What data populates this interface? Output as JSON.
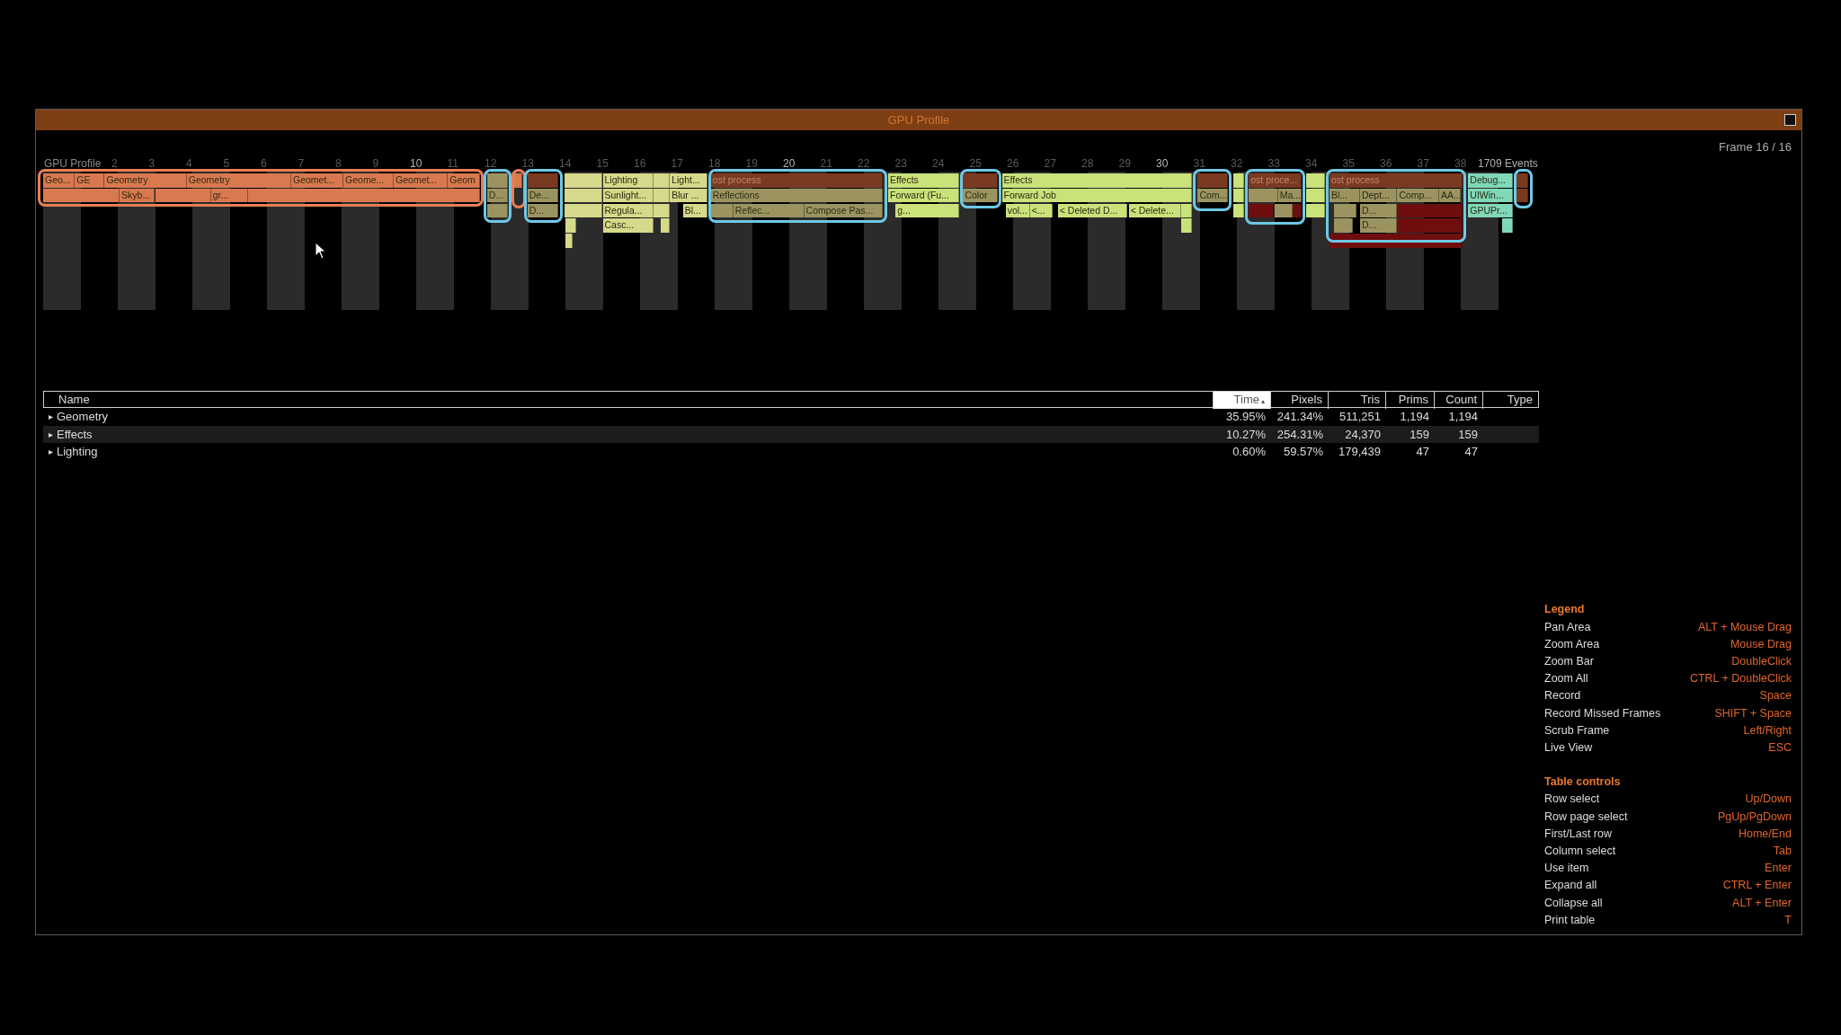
{
  "window": {
    "title": "GPU Profile",
    "frame_indicator": "Frame 16 / 16"
  },
  "timeline": {
    "title": "GPU Profile",
    "frame_labels": [
      {
        "label": "2",
        "major": false
      },
      {
        "label": "3",
        "major": false
      },
      {
        "label": "4",
        "major": false
      },
      {
        "label": "5",
        "major": false
      },
      {
        "label": "6",
        "major": false
      },
      {
        "label": "7",
        "major": false
      },
      {
        "label": "8",
        "major": false
      },
      {
        "label": "9",
        "major": false
      },
      {
        "label": "10",
        "major": true
      },
      {
        "label": "11",
        "major": false
      },
      {
        "label": "12",
        "major": false
      },
      {
        "label": "13",
        "major": false
      },
      {
        "label": "14",
        "major": false
      },
      {
        "label": "15",
        "major": false
      },
      {
        "label": "16",
        "major": false
      },
      {
        "label": "17",
        "major": false
      },
      {
        "label": "18",
        "major": false
      },
      {
        "label": "19",
        "major": false
      },
      {
        "label": "20",
        "major": true
      },
      {
        "label": "21",
        "major": false
      },
      {
        "label": "22",
        "major": false
      },
      {
        "label": "23",
        "major": false
      },
      {
        "label": "24",
        "major": false
      },
      {
        "label": "25",
        "major": false
      },
      {
        "label": "26",
        "major": false
      },
      {
        "label": "27",
        "major": false
      },
      {
        "label": "28",
        "major": false
      },
      {
        "label": "29",
        "major": false
      },
      {
        "label": "30",
        "major": true
      },
      {
        "label": "31",
        "major": false
      },
      {
        "label": "32",
        "major": false
      },
      {
        "label": "33",
        "major": false
      },
      {
        "label": "34",
        "major": false
      },
      {
        "label": "35",
        "major": false
      },
      {
        "label": "36",
        "major": false
      },
      {
        "label": "37",
        "major": false
      },
      {
        "label": "38",
        "major": false
      }
    ],
    "event_count": "1709 Events",
    "rows": [
      {
        "bars": [
          {
            "label": "Geo...",
            "color": "#d9794f"
          },
          {
            "label": "GE",
            "color": "#d9794f"
          },
          {
            "label": "Geometry",
            "color": "#d9794f"
          },
          {
            "label": "Geometry",
            "color": "#d9794f"
          },
          {
            "label": "Geomet...",
            "color": "#d9794f"
          },
          {
            "label": "Geome...",
            "color": "#d9794f"
          },
          {
            "label": "Geomet...",
            "color": "#d9794f"
          },
          {
            "label": "Geom",
            "color": "#d9794f"
          },
          {
            "color": "#9c9460"
          },
          {
            "color": "#d9794f"
          },
          {
            "color": "#7a3a22"
          },
          {
            "color": "#d6d98a"
          },
          {
            "label": "Lighting",
            "color": "#d6d98a"
          },
          {
            "color": "#d6d98a"
          },
          {
            "label": "Light...",
            "color": "#d6d98a"
          },
          {
            "label": "ost process",
            "color": "#7a3a22"
          },
          {
            "label": "Effects",
            "color": "#c9e27a"
          },
          {
            "color": "#7a3a22"
          },
          {
            "label": "Effects",
            "color": "#c9e27a"
          },
          {
            "color": "#7a3a22"
          },
          {
            "color": "#c9e27a"
          },
          {
            "label": "ost proce...",
            "color": "#7a3a22"
          },
          {
            "color": "#c9e27a"
          },
          {
            "label": "ost process",
            "color": "#7a3a22"
          },
          {
            "label": "Debug...",
            "color": "#7fd8b8"
          },
          {
            "color": "#7a3a22"
          }
        ]
      },
      {
        "bars": [
          {
            "color": "#d9794f"
          },
          {
            "label": "Skyb...",
            "color": "#d9794f"
          },
          {
            "color": "#d9794f"
          },
          {
            "label": "gr...",
            "color": "#d9794f"
          },
          {
            "color": "#d9794f"
          },
          {
            "label": "D...",
            "color": "#9c9460"
          },
          {
            "label": "De...",
            "color": "#9c9460"
          },
          {
            "color": "#d6d98a"
          },
          {
            "label": "Sunlight...",
            "color": "#d6d98a"
          },
          {
            "color": "#d6d98a"
          },
          {
            "label": "Blur ...",
            "color": "#d6d98a"
          },
          {
            "label": "Reflections",
            "color": "#9c9460"
          },
          {
            "label": "Forward (Fu...",
            "color": "#c9e27a"
          },
          {
            "label": "Color",
            "color": "#9c9460"
          },
          {
            "label": "Forward Job",
            "color": "#c9e27a"
          },
          {
            "label": "Com...",
            "color": "#9c9460"
          },
          {
            "color": "#c9e27a"
          },
          {
            "color": "#9c9460"
          },
          {
            "label": "Ma...",
            "color": "#9c9460"
          },
          {
            "color": "#c9e27a"
          },
          {
            "label": "Bl...",
            "color": "#9c9460"
          },
          {
            "label": "Dept...",
            "color": "#9c9460"
          },
          {
            "label": "Comp...",
            "color": "#9c9460"
          },
          {
            "label": "AA...",
            "color": "#9c9460"
          },
          {
            "label": "UIWin...",
            "color": "#7fd8b8"
          },
          {
            "color": "#7a3a22"
          }
        ]
      },
      {
        "bars": [
          {
            "color": "#9c9460"
          },
          {
            "label": "D...",
            "color": "#9c9460"
          },
          {
            "color": "#d6d98a"
          },
          {
            "label": "Regula...",
            "color": "#d6d98a"
          },
          {
            "color": "#d6d98a"
          },
          {
            "label": "Bl...",
            "color": "#d6d98a"
          },
          {
            "color": "#9c9460"
          },
          {
            "label": "Reflec...",
            "color": "#9c9460"
          },
          {
            "label": "Compose Pas...",
            "color": "#9c9460"
          },
          {
            "label": "g...",
            "color": "#c9e27a"
          },
          {
            "label": "vol...",
            "color": "#c9e27a"
          },
          {
            "label": "<...",
            "color": "#c9e27a"
          },
          {
            "label": "< Deleted D...",
            "color": "#c9e27a"
          },
          {
            "label": "< Delete...",
            "color": "#c9e27a"
          },
          {
            "color": "#c9e27a"
          },
          {
            "color": "#c9e27a"
          },
          {
            "color": "#6e0e0e"
          },
          {
            "color": "#9c9460"
          },
          {
            "color": "#6e0e0e"
          },
          {
            "color": "#c9e27a"
          },
          {
            "color": "#9c9460"
          },
          {
            "label": "D...",
            "color": "#9c9460"
          },
          {
            "color": "#6e0e0e"
          },
          {
            "label": "GPUPr...",
            "color": "#7fd8b8"
          }
        ]
      },
      {
        "bars": [
          {
            "color": "#d6d98a"
          },
          {
            "label": "Casc...",
            "color": "#d6d98a"
          },
          {
            "color": "#d6d98a"
          },
          {
            "color": "#c9e27a"
          },
          {
            "color": "#9c9460"
          },
          {
            "label": "D...",
            "color": "#9c9460"
          },
          {
            "color": "#6e0e0e"
          },
          {
            "color": "#7fd8b8"
          }
        ]
      },
      {
        "bars": [
          {
            "color": "#d6d98a"
          },
          {
            "color": "#6e0e0e"
          }
        ]
      }
    ],
    "annotations": [
      {
        "color": "#ee7d55"
      },
      {
        "color": "#ee7d55"
      },
      {
        "color": "#6fc8e6"
      },
      {
        "color": "#6fc8e6"
      },
      {
        "color": "#6fc8e6"
      },
      {
        "color": "#6fc8e6"
      },
      {
        "color": "#6fc8e6"
      },
      {
        "color": "#6fc8e6"
      },
      {
        "color": "#6fc8e6"
      },
      {
        "color": "#6fc8e6"
      }
    ]
  },
  "table": {
    "columns": [
      {
        "label": "Name",
        "selected": false
      },
      {
        "label": "Time",
        "selected": true
      },
      {
        "label": "Pixels",
        "selected": false
      },
      {
        "label": "Tris",
        "selected": false
      },
      {
        "label": "Prims",
        "selected": false
      },
      {
        "label": "Count",
        "selected": false
      },
      {
        "label": "Type",
        "selected": false
      }
    ],
    "sort_indicator": "▴",
    "rows": [
      {
        "expander": "▸",
        "cells": [
          "Geometry",
          "35.95%",
          "241.34%",
          "511,251",
          "1,194",
          "1,194"
        ]
      },
      {
        "expander": "▸",
        "cells": [
          "Effects",
          "10.27%",
          "254.31%",
          "24,370",
          "159",
          "159"
        ]
      },
      {
        "expander": "▸",
        "cells": [
          "Lighting",
          "0.60%",
          "59.57%",
          "179,439",
          "47",
          "47"
        ]
      }
    ]
  },
  "legend": {
    "sections": [
      {
        "title": "Legend",
        "items": [
          {
            "action": "Pan Area",
            "shortcut": "ALT + Mouse Drag"
          },
          {
            "action": "Zoom Area",
            "shortcut": "Mouse Drag"
          },
          {
            "action": "Zoom Bar",
            "shortcut": "DoubleClick"
          },
          {
            "action": "Zoom All",
            "shortcut": "CTRL + DoubleClick"
          },
          {
            "action": "Record",
            "shortcut": "Space"
          },
          {
            "action": "Record Missed Frames",
            "shortcut": "SHIFT + Space"
          },
          {
            "action": "Scrub Frame",
            "shortcut": "Left/Right"
          },
          {
            "action": "Live View",
            "shortcut": "ESC"
          }
        ]
      },
      {
        "title": "Table controls",
        "items": [
          {
            "action": "Row select",
            "shortcut": "Up/Down"
          },
          {
            "action": "Row page select",
            "shortcut": "PgUp/PgDown"
          },
          {
            "action": "First/Last row",
            "shortcut": "Home/End"
          },
          {
            "action": "Column select",
            "shortcut": "Tab"
          },
          {
            "action": "Use item",
            "shortcut": "Enter"
          },
          {
            "action": "Expand all",
            "shortcut": "CTRL + Enter"
          },
          {
            "action": "Collapse all",
            "shortcut": "ALT + Enter"
          },
          {
            "action": "Print table",
            "shortcut": "T"
          }
        ]
      }
    ]
  }
}
